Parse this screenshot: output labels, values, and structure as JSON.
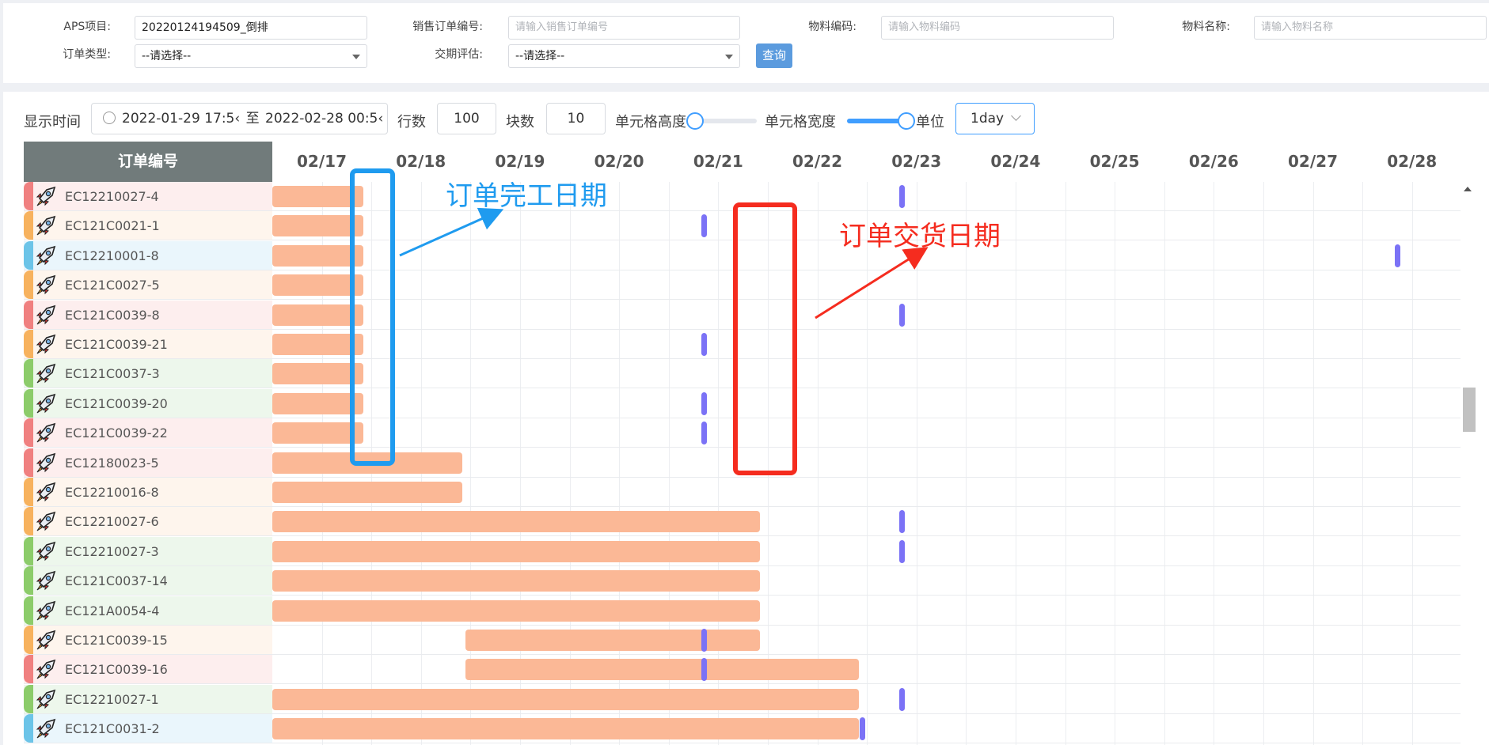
{
  "filters": {
    "aps_project": {
      "label": "APS项目:",
      "value": "20220124194509_倒排"
    },
    "sales_order": {
      "label": "销售订单编号:",
      "placeholder": "请输入销售订单编号"
    },
    "material_code": {
      "label": "物料编码:",
      "placeholder": "请输入物料编码"
    },
    "material_name": {
      "label": "物料名称:",
      "placeholder": "请输入物料名称"
    },
    "order_type": {
      "label": "订单类型:",
      "value": "--请选择--"
    },
    "delivery_eval": {
      "label": "交期评估:",
      "value": "--请选择--"
    },
    "query_label": "查询"
  },
  "toolbar": {
    "display_time_label": "显示时间",
    "date_start": "2022-01-29 17:5‹",
    "date_sep": "至",
    "date_end": "2022-02-28 00:5‹",
    "rows_label": "行数",
    "rows_value": "100",
    "blocks_label": "块数",
    "blocks_value": "10",
    "cell_height_label": "单元格高度",
    "cell_height_level": 0.0,
    "cell_width_label": "单元格宽度",
    "cell_width_level": 1.0,
    "unit_label": "单位",
    "unit_value": "1day"
  },
  "gantt": {
    "order_column_header": "订单编号",
    "dates": [
      "02/17",
      "02/18",
      "02/19",
      "02/20",
      "02/21",
      "02/22",
      "02/23",
      "02/24",
      "02/25",
      "02/26",
      "02/27",
      "02/28"
    ],
    "colors": {
      "red": "#f08080",
      "orange": "#f7b25e",
      "blue": "#6cc4e8",
      "green": "#8ccc6a",
      "bar": "#fbb896",
      "marker": "#7b72f6"
    },
    "tint": {
      "red": "#fdeeee",
      "orange": "#fef5ed",
      "blue": "#eaf6fc",
      "green": "#edf7ec"
    },
    "rows": [
      {
        "code": "EC12210027-4",
        "status": "red",
        "bar": [
          0,
          0.92
        ],
        "mark": 6.35
      },
      {
        "code": "EC121C0021-1",
        "status": "orange",
        "bar": [
          0,
          0.92
        ],
        "mark": 4.35
      },
      {
        "code": "EC12210001-8",
        "status": "blue",
        "bar": [
          0,
          0.92
        ],
        "mark": 11.35
      },
      {
        "code": "EC121C0027-5",
        "status": "orange",
        "bar": [
          0,
          0.92
        ],
        "mark": null
      },
      {
        "code": "EC121C0039-8",
        "status": "red",
        "bar": [
          0,
          0.92
        ],
        "mark": 6.35
      },
      {
        "code": "EC121C0039-21",
        "status": "orange",
        "bar": [
          0,
          0.92
        ],
        "mark": 4.35
      },
      {
        "code": "EC121C0037-3",
        "status": "green",
        "bar": [
          0,
          0.92
        ],
        "mark": null
      },
      {
        "code": "EC121C0039-20",
        "status": "green",
        "bar": [
          0,
          0.92
        ],
        "mark": 4.35
      },
      {
        "code": "EC121C0039-22",
        "status": "red",
        "bar": [
          0,
          0.92
        ],
        "mark": 4.35
      },
      {
        "code": "EC12180023-5",
        "status": "red",
        "bar": [
          0,
          1.92
        ],
        "mark": null
      },
      {
        "code": "EC12210016-8",
        "status": "orange",
        "bar": [
          0,
          1.92
        ],
        "mark": null
      },
      {
        "code": "EC12210027-6",
        "status": "orange",
        "bar": [
          0,
          4.92
        ],
        "mark": 6.35
      },
      {
        "code": "EC12210027-3",
        "status": "green",
        "bar": [
          0,
          4.92
        ],
        "mark": 6.35
      },
      {
        "code": "EC121C0037-14",
        "status": "green",
        "bar": [
          0,
          4.92
        ],
        "mark": null
      },
      {
        "code": "EC121A0054-4",
        "status": "green",
        "bar": [
          0,
          4.92
        ],
        "mark": null
      },
      {
        "code": "EC121C0039-15",
        "status": "orange",
        "bar": [
          1.95,
          4.92
        ],
        "mark": 4.35
      },
      {
        "code": "EC121C0039-16",
        "status": "red",
        "bar": [
          1.95,
          5.92
        ],
        "mark": 4.35
      },
      {
        "code": "EC12210027-1",
        "status": "green",
        "bar": [
          0,
          5.92
        ],
        "mark": 6.35
      },
      {
        "code": "EC121C0031-2",
        "status": "blue",
        "bar": [
          0,
          5.92
        ],
        "mark": 5.95
      }
    ]
  },
  "annotations": {
    "completion_label": "订单完工日期",
    "completion_color": "#1f9bef",
    "delivery_label": "订单交货日期",
    "delivery_color": "#f52c1f"
  }
}
